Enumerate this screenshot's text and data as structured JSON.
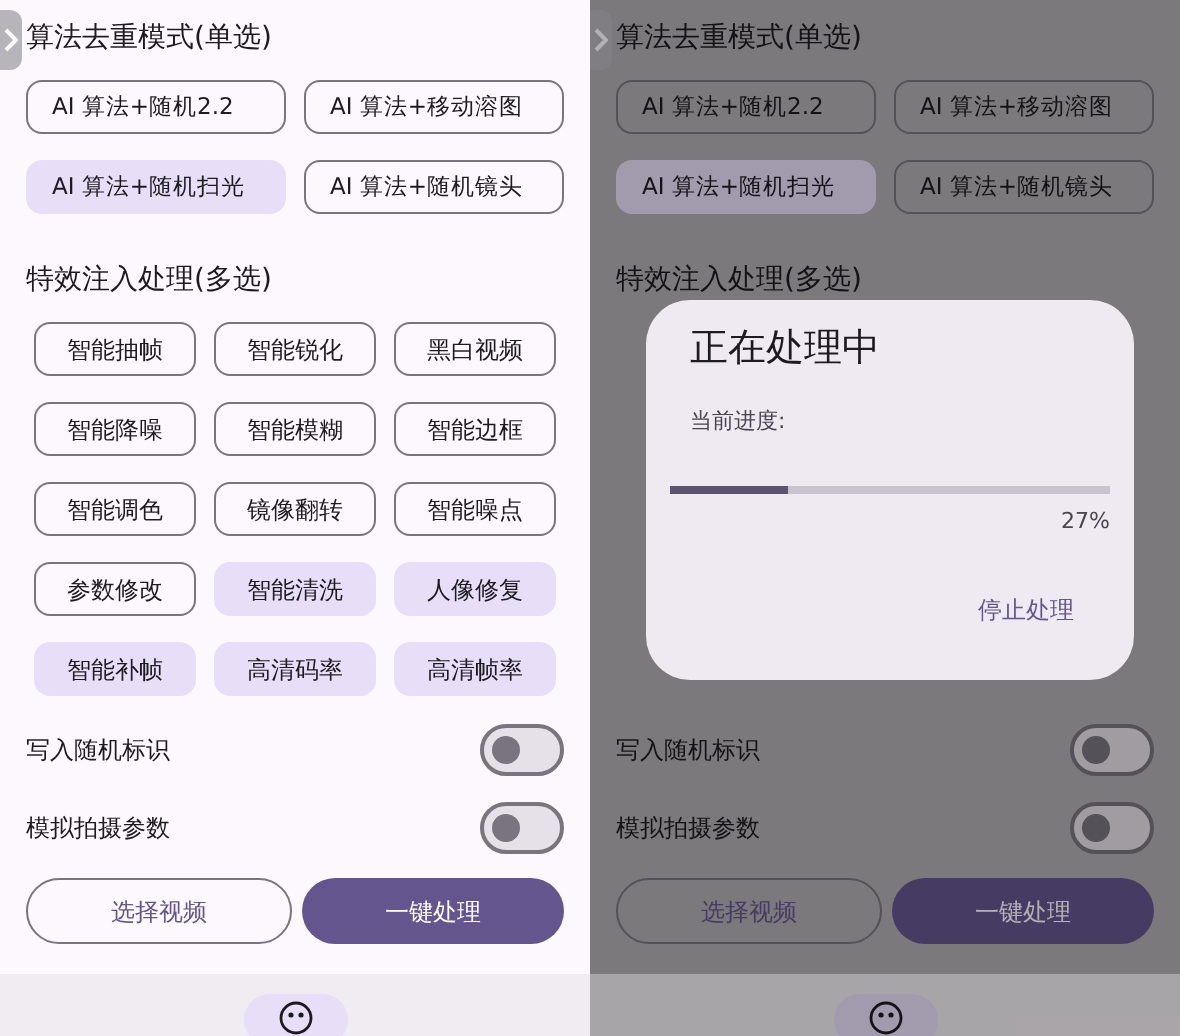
{
  "screens": [
    {
      "dimmed": false,
      "mode_title": "算法去重模式(单选)",
      "modes": [
        {
          "label": "AI 算法+随机2.2",
          "selected": false
        },
        {
          "label": "AI 算法+移动溶图",
          "selected": false
        },
        {
          "label": "AI 算法+随机扫光",
          "selected": true
        },
        {
          "label": "AI 算法+随机镜头",
          "selected": false
        }
      ],
      "effects_title": "特效注入处理(多选)",
      "effects": [
        {
          "label": "智能抽帧",
          "selected": false
        },
        {
          "label": "智能锐化",
          "selected": false
        },
        {
          "label": "黑白视频",
          "selected": false
        },
        {
          "label": "智能降噪",
          "selected": false
        },
        {
          "label": "智能模糊",
          "selected": false
        },
        {
          "label": "智能边框",
          "selected": false
        },
        {
          "label": "智能调色",
          "selected": false
        },
        {
          "label": "镜像翻转",
          "selected": false
        },
        {
          "label": "智能噪点",
          "selected": false
        },
        {
          "label": "参数修改",
          "selected": false
        },
        {
          "label": "智能清洗",
          "selected": true
        },
        {
          "label": "人像修复",
          "selected": true
        },
        {
          "label": "智能补帧",
          "selected": true
        },
        {
          "label": "高清码率",
          "selected": true
        },
        {
          "label": "高清帧率",
          "selected": true
        }
      ],
      "toggles": [
        {
          "label": "写入随机标识",
          "on": false
        },
        {
          "label": "模拟拍摄参数",
          "on": false
        }
      ],
      "actions": [
        {
          "label": "选择视频",
          "kind": "outline"
        },
        {
          "label": "一键处理",
          "kind": "filled"
        }
      ]
    },
    {
      "dimmed": true,
      "mode_title": "算法去重模式(单选)",
      "modes": [
        {
          "label": "AI 算法+随机2.2",
          "selected": false
        },
        {
          "label": "AI 算法+移动溶图",
          "selected": false
        },
        {
          "label": "AI 算法+随机扫光",
          "selected": true
        },
        {
          "label": "AI 算法+随机镜头",
          "selected": false
        }
      ],
      "effects_title": "特效注入处理(多选)",
      "toggles": [
        {
          "label": "写入随机标识",
          "on": false
        },
        {
          "label": "模拟拍摄参数",
          "on": false
        }
      ],
      "actions": [
        {
          "label": "选择视频",
          "kind": "outline"
        },
        {
          "label": "一键处理",
          "kind": "filled"
        }
      ],
      "dialog": {
        "title": "正在处理中",
        "progress_label": "当前进度:",
        "level": 0.27,
        "percent": "27%",
        "button": "停止处理"
      }
    }
  ]
}
